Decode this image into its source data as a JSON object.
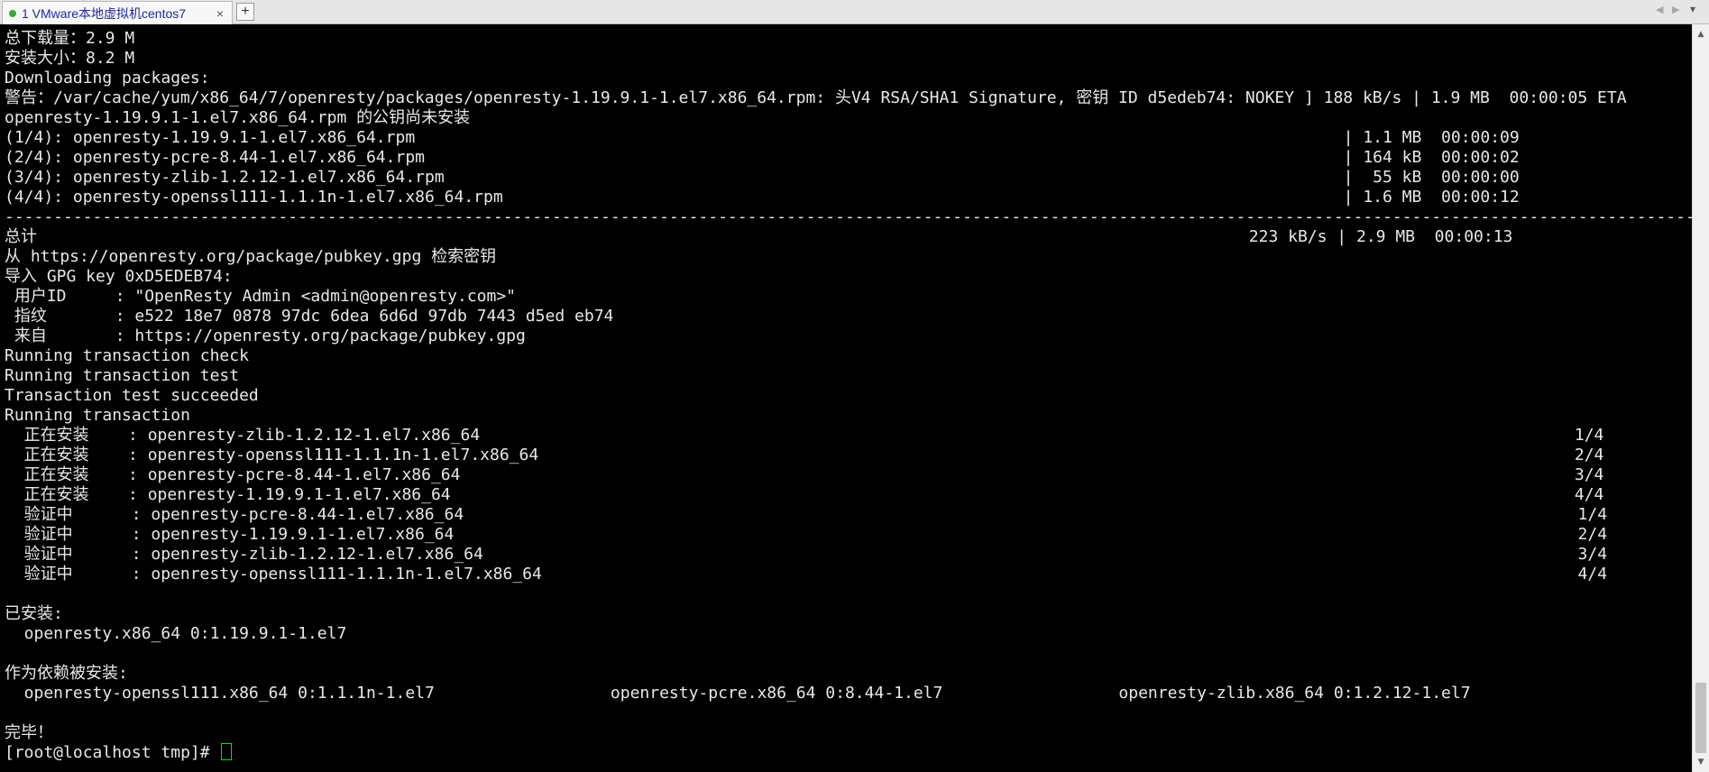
{
  "tabbar": {
    "tab_label": "1 VMware本地虚拟机centos7",
    "close_glyph": "×",
    "new_tab_glyph": "+",
    "nav_prev_glyph": "◀",
    "nav_next_glyph": "▶",
    "menu_glyph": "▾"
  },
  "terminal": {
    "lines": [
      "总下载量：2.9 M",
      "安装大小：8.2 M",
      "Downloading packages:",
      "警告：/var/cache/yum/x86_64/7/openresty/packages/openresty-1.19.9.1-1.el7.x86_64.rpm: 头V4 RSA/SHA1 Signature, 密钥 ID d5edeb74: NOKEY ] 188 kB/s | 1.9 MB  00:00:05 ETA",
      "openresty-1.19.9.1-1.el7.x86_64.rpm 的公钥尚未安装",
      "(1/4): openresty-1.19.9.1-1.el7.x86_64.rpm                                                                                               | 1.1 MB  00:00:09",
      "(2/4): openresty-pcre-8.44-1.el7.x86_64.rpm                                                                                              | 164 kB  00:00:02",
      "(3/4): openresty-zlib-1.2.12-1.el7.x86_64.rpm                                                                                            |  55 kB  00:00:00",
      "(4/4): openresty-openssl111-1.1.1n-1.el7.x86_64.rpm                                                                                      | 1.6 MB  00:00:12",
      "-----------------------------------------------------------------------------------------------------------------------------------------------------------------------------",
      "总计                                                                                                                            223 kB/s | 2.9 MB  00:00:13",
      "从 https://openresty.org/package/pubkey.gpg 检索密钥",
      "导入 GPG key 0xD5EDEB74:",
      " 用户ID     : \"OpenResty Admin <admin@openresty.com>\"",
      " 指纹       : e522 18e7 0878 97dc 6dea 6d6d 97db 7443 d5ed eb74",
      " 来自       : https://openresty.org/package/pubkey.gpg",
      "Running transaction check",
      "Running transaction test",
      "Transaction test succeeded",
      "Running transaction",
      "  正在安装    : openresty-zlib-1.2.12-1.el7.x86_64                                                                                                                1/4",
      "  正在安装    : openresty-openssl111-1.1.1n-1.el7.x86_64                                                                                                          2/4",
      "  正在安装    : openresty-pcre-8.44-1.el7.x86_64                                                                                                                  3/4",
      "  正在安装    : openresty-1.19.9.1-1.el7.x86_64                                                                                                                   4/4",
      "  验证中      : openresty-pcre-8.44-1.el7.x86_64                                                                                                                  1/4",
      "  验证中      : openresty-1.19.9.1-1.el7.x86_64                                                                                                                   2/4",
      "  验证中      : openresty-zlib-1.2.12-1.el7.x86_64                                                                                                                3/4",
      "  验证中      : openresty-openssl111-1.1.1n-1.el7.x86_64                                                                                                          4/4",
      "",
      "已安装:",
      "  openresty.x86_64 0:1.19.9.1-1.el7",
      "",
      "作为依赖被安装:",
      "  openresty-openssl111.x86_64 0:1.1.1n-1.el7                  openresty-pcre.x86_64 0:8.44-1.el7                  openresty-zlib.x86_64 0:1.2.12-1.el7",
      "",
      "完毕！"
    ],
    "prompt": "[root@localhost tmp]# "
  },
  "scrollbar": {
    "up_glyph": "▲",
    "down_glyph": "▼"
  },
  "colors": {
    "background": "#000000",
    "text": "#e8e8e8",
    "cursor": "#22d322",
    "tab_text": "#1f2a9c",
    "tab_status_dot": "#3aa53a"
  }
}
